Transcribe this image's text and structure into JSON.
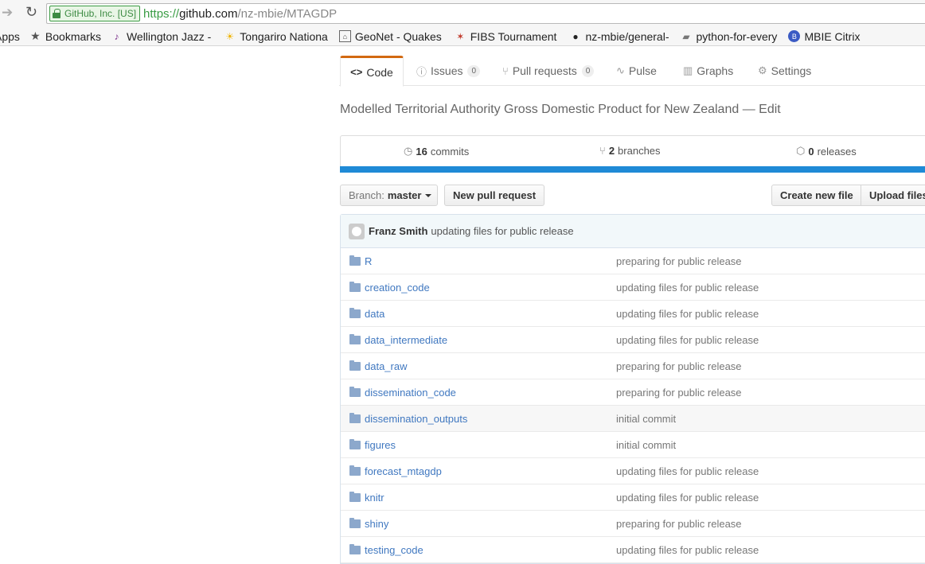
{
  "browser": {
    "ev_label": "GitHub, Inc. [US]",
    "url_scheme": "https://",
    "url_host": "github.com",
    "url_path": "/nz-mbie/MTAGDP"
  },
  "bookmarks": [
    {
      "label": "Apps",
      "icon": "apps-icon"
    },
    {
      "label": "Bookmarks",
      "icon": "star-icon"
    },
    {
      "label": "Wellington Jazz -",
      "icon": "jazz-icon"
    },
    {
      "label": "Tongariro Nationa",
      "icon": "weather-icon"
    },
    {
      "label": "GeoNet - Quakes",
      "icon": "geonet-icon"
    },
    {
      "label": "FIBS Tournament",
      "icon": "fibs-icon"
    },
    {
      "label": "nz-mbie/general-",
      "icon": "github-icon"
    },
    {
      "label": "python-for-every",
      "icon": "folder-icon"
    },
    {
      "label": "MBIE Citrix",
      "icon": "citrix-icon"
    }
  ],
  "tabs": {
    "code": "Code",
    "issues": "Issues",
    "issues_count": "0",
    "pulls": "Pull requests",
    "pulls_count": "0",
    "pulse": "Pulse",
    "graphs": "Graphs",
    "settings": "Settings"
  },
  "repo": {
    "description": "Modelled Territorial Authority Gross Domestic Product for New Zealand",
    "edit": "Edit"
  },
  "summary": {
    "commits_count": "16",
    "commits_label": "commits",
    "branches_count": "2",
    "branches_label": "branches",
    "releases_count": "0",
    "releases_label": "releases"
  },
  "toolbar": {
    "branch_label": "Branch:",
    "branch_value": "master",
    "new_pull_request": "New pull request",
    "create_new_file": "Create new file",
    "upload_files": "Upload files"
  },
  "latest_commit": {
    "author": "Franz Smith",
    "message": "updating files for public release"
  },
  "files": [
    {
      "name": "R",
      "message": "preparing for public release"
    },
    {
      "name": "creation_code",
      "message": "updating files for public release"
    },
    {
      "name": "data",
      "message": "updating files for public release"
    },
    {
      "name": "data_intermediate",
      "message": "updating files for public release"
    },
    {
      "name": "data_raw",
      "message": "preparing for public release"
    },
    {
      "name": "dissemination_code",
      "message": "preparing for public release"
    },
    {
      "name": "dissemination_outputs",
      "message": "initial commit"
    },
    {
      "name": "figures",
      "message": "initial commit"
    },
    {
      "name": "forecast_mtagdp",
      "message": "updating files for public release"
    },
    {
      "name": "knitr",
      "message": "updating files for public release"
    },
    {
      "name": "shiny",
      "message": "preparing for public release"
    },
    {
      "name": "testing_code",
      "message": "updating files for public release"
    }
  ],
  "colors": {
    "accent_tab": "#d26911",
    "language_bar": "#1f8ad6",
    "link": "#4078c0"
  }
}
